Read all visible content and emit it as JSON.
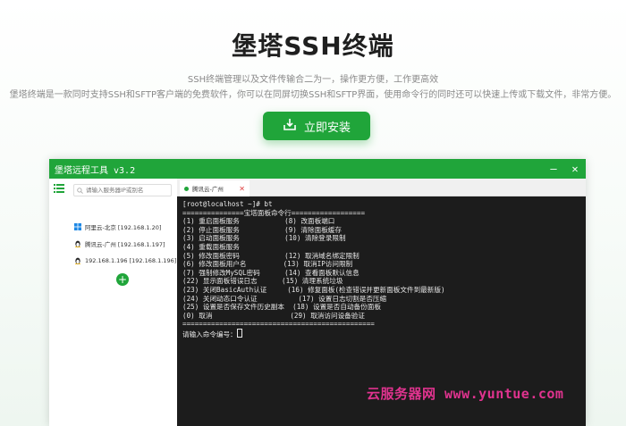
{
  "hero": {
    "title": "堡塔SSH终端",
    "subtitle": "SSH终端管理以及文件传输合二为一，操作更方便，工作更高效",
    "description": "堡塔终端是一款同时支持SSH和SFTP客户端的免费软件，你可以在同屏切换SSH和SFTP界面，使用命令行的同时还可以快速上传或下载文件，非常方便。",
    "install_label": "立即安装",
    "install_icon": "download-icon"
  },
  "app": {
    "title": "堡塔远程工具 v3.2",
    "minimize": "—",
    "close": "✕",
    "search_placeholder": "请输入服务器IP或别名",
    "servers": [
      {
        "os": "windows",
        "label": "阿里云-北京 [192.168.1.20]"
      },
      {
        "os": "linux",
        "label": "腾讯云-广州 [192.168.1.197]"
      },
      {
        "os": "linux",
        "label": "192.168.1.196 [192.168.1.196]"
      }
    ],
    "add_label": "+",
    "tab": {
      "label": "腾讯云-广州",
      "close": "✕"
    }
  },
  "terminal": {
    "lines": [
      "[root@localhost ~]# bt",
      "===============宝塔面板命令行==================",
      "(1) 重启面板服务           (8) 改面板端口",
      "(2) 停止面板服务           (9) 清除面板缓存",
      "(3) 启动面板服务           (10) 清除登录限制",
      "(4) 重载面板服务",
      "(5) 修改面板密码           (12) 取消域名绑定限制",
      "(6) 修改面板用户名         (13) 取消IP访问限制",
      "(7) 强制修改MySQL密码      (14) 查看面板默认信息",
      "(22) 显示面板错误日志      (15) 清理系统垃圾",
      "(23) 关闭BasicAuth认证     (16) 修复面板(检查错误并更新面板文件到最新版)",
      "(24) 关闭动态口令认证          (17) 设置日志切割是否压缩",
      "(25) 设置是否保存文件历史副本  (18) 设置是否自动备份面板",
      "(0) 取消                   (29) 取消访问设备验证",
      "==============================================="
    ],
    "prompt": "请输入命令编号："
  },
  "watermark": "云服务器网 www.yuntue.com",
  "colors": {
    "brand": "#20a53a",
    "terminal_bg": "#1c1c1c",
    "watermark": "#e0338f"
  }
}
